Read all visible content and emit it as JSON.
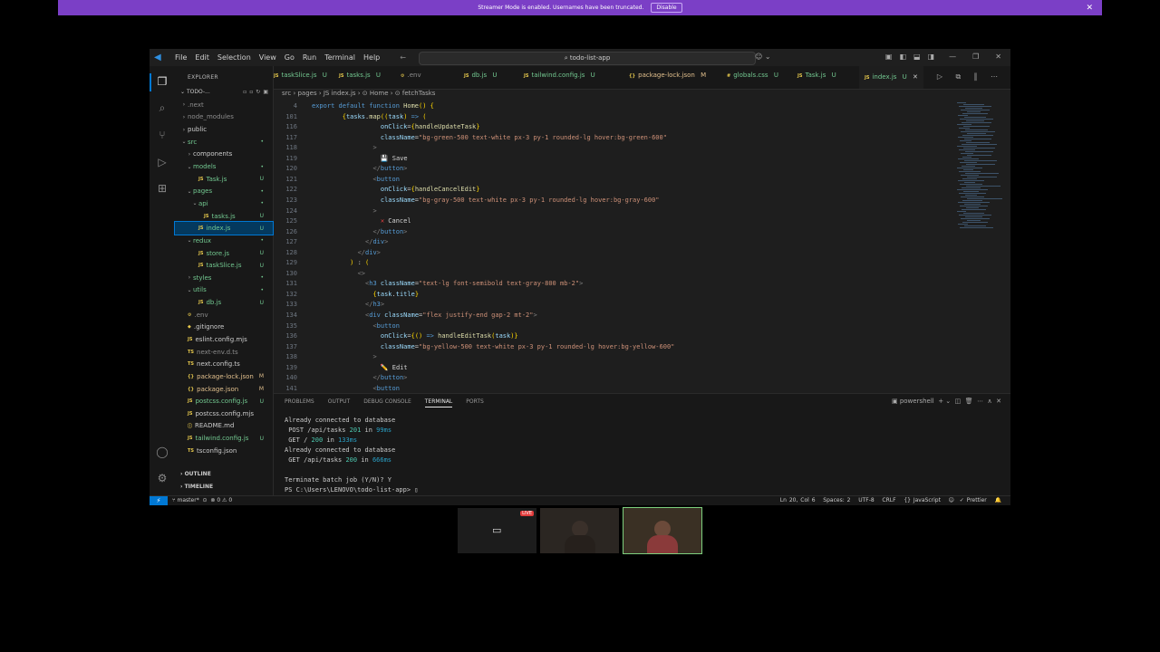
{
  "streamer_banner": {
    "text": "Streamer Mode is enabled. Usernames have been truncated.",
    "disable_label": "Disable",
    "close": "✕"
  },
  "titlebar": {
    "menu": [
      "File",
      "Edit",
      "Selection",
      "View",
      "Go",
      "Run",
      "Terminal",
      "Help"
    ],
    "search": "todo-list-app"
  },
  "sidebar": {
    "title": "EXPLORER",
    "root": "TODO-...",
    "tree": [
      {
        "name": ".next",
        "indent": 1,
        "chev": "›",
        "color": "grey",
        "status": ""
      },
      {
        "name": "node_modules",
        "indent": 1,
        "chev": "›",
        "color": "grey",
        "status": ""
      },
      {
        "name": "public",
        "indent": 1,
        "chev": "›",
        "color": "normal",
        "status": ""
      },
      {
        "name": "src",
        "indent": 1,
        "chev": "⌄",
        "color": "green",
        "status": "•"
      },
      {
        "name": "components",
        "indent": 2,
        "chev": "›",
        "color": "normal",
        "status": ""
      },
      {
        "name": "models",
        "indent": 2,
        "chev": "⌄",
        "color": "green",
        "status": "•"
      },
      {
        "name": "Task.js",
        "indent": 3,
        "icon": "JS",
        "color": "green",
        "status": "U"
      },
      {
        "name": "pages",
        "indent": 2,
        "chev": "⌄",
        "color": "green",
        "status": "•"
      },
      {
        "name": "api",
        "indent": 3,
        "chev": "⌄",
        "color": "green",
        "status": "•"
      },
      {
        "name": "tasks.js",
        "indent": 4,
        "icon": "JS",
        "color": "green",
        "status": "U"
      },
      {
        "name": "index.js",
        "indent": 3,
        "icon": "JS",
        "color": "green",
        "status": "U",
        "selected": true
      },
      {
        "name": "redux",
        "indent": 2,
        "chev": "⌄",
        "color": "green",
        "status": "•"
      },
      {
        "name": "store.js",
        "indent": 3,
        "icon": "JS",
        "color": "green",
        "status": "U"
      },
      {
        "name": "taskSlice.js",
        "indent": 3,
        "icon": "JS",
        "color": "green",
        "status": "U"
      },
      {
        "name": "styles",
        "indent": 2,
        "chev": "›",
        "color": "green",
        "status": "•"
      },
      {
        "name": "utils",
        "indent": 2,
        "chev": "⌄",
        "color": "green",
        "status": "•"
      },
      {
        "name": "db.js",
        "indent": 3,
        "icon": "JS",
        "color": "green",
        "status": "U"
      },
      {
        "name": ".env",
        "indent": 1,
        "icon": "⚙",
        "color": "grey",
        "status": ""
      },
      {
        "name": ".gitignore",
        "indent": 1,
        "icon": "◆",
        "color": "normal",
        "status": ""
      },
      {
        "name": "eslint.config.mjs",
        "indent": 1,
        "icon": "JS",
        "color": "normal",
        "status": ""
      },
      {
        "name": "next-env.d.ts",
        "indent": 1,
        "icon": "TS",
        "color": "grey",
        "status": ""
      },
      {
        "name": "next.config.ts",
        "indent": 1,
        "icon": "TS",
        "color": "normal",
        "status": ""
      },
      {
        "name": "package-lock.json",
        "indent": 1,
        "icon": "{}",
        "color": "yellow",
        "status": "M"
      },
      {
        "name": "package.json",
        "indent": 1,
        "icon": "{}",
        "color": "yellow",
        "status": "M"
      },
      {
        "name": "postcss.config.js",
        "indent": 1,
        "icon": "JS",
        "color": "green",
        "status": "U"
      },
      {
        "name": "postcss.config.mjs",
        "indent": 1,
        "icon": "JS",
        "color": "normal",
        "status": ""
      },
      {
        "name": "README.md",
        "indent": 1,
        "icon": "ⓘ",
        "color": "normal",
        "status": ""
      },
      {
        "name": "tailwind.config.js",
        "indent": 1,
        "icon": "JS",
        "color": "green",
        "status": "U"
      },
      {
        "name": "tsconfig.json",
        "indent": 1,
        "icon": "TS",
        "color": "normal",
        "status": ""
      }
    ],
    "outline": "OUTLINE",
    "timeline": "TIMELINE"
  },
  "tabs": [
    {
      "icon": "JS",
      "label": "taskSlice.js",
      "status": "U",
      "color": "green"
    },
    {
      "icon": "JS",
      "label": "tasks.js",
      "status": "U",
      "color": "green"
    },
    {
      "icon": "⚙",
      "label": ".env",
      "status": "",
      "color": "grey"
    },
    {
      "icon": "JS",
      "label": "db.js",
      "status": "U",
      "color": "green"
    },
    {
      "icon": "JS",
      "label": "tailwind.config.js",
      "status": "U",
      "color": "green"
    },
    {
      "icon": "{}",
      "label": "package-lock.json",
      "status": "M",
      "color": "yellow"
    },
    {
      "icon": "#",
      "label": "globals.css",
      "status": "U",
      "color": "green"
    },
    {
      "icon": "JS",
      "label": "Task.js",
      "status": "U",
      "color": "green"
    },
    {
      "icon": "JS",
      "label": "index.js",
      "status": "U",
      "color": "green",
      "active": true
    }
  ],
  "breadcrumb": "src › pages › JS index.js › ⊙ Home › ⊙ fetchTasks",
  "code_lines": [
    {
      "n": "4",
      "html": "<span class='kw'>export default function</span> <span class='fn'>Home</span><span class='br'>()</span> <span class='br'>{</span>"
    },
    {
      "n": "101",
      "html": "        <span class='br'>{</span><span class='attr'>tasks</span>.<span class='fn'>map</span><span class='br'>((</span><span class='attr'>task</span><span class='br'>)</span> <span class='kw'>=></span> <span class='br'>(</span>"
    },
    {
      "n": "116",
      "html": "                  <span class='attr'>onClick</span>=<span class='br'>{</span><span class='fn'>handleUpdateTask</span><span class='br'>}</span>"
    },
    {
      "n": "117",
      "html": "                  <span class='attr'>className</span>=<span class='str'>\"bg-green-500 text-white px-3 py-1 rounded-lg hover:bg-green-600\"</span>"
    },
    {
      "n": "118",
      "html": "                <span class='tag'>></span>"
    },
    {
      "n": "119",
      "html": "                  <span class='txt'>💾 Save</span>"
    },
    {
      "n": "120",
      "html": "                <span class='tag'>&lt;/</span><span class='tagn'>button</span><span class='tag'>></span>"
    },
    {
      "n": "121",
      "html": "                <span class='tag'>&lt;</span><span class='tagn'>button</span>"
    },
    {
      "n": "122",
      "html": "                  <span class='attr'>onClick</span>=<span class='br'>{</span><span class='fn'>handleCancelEdit</span><span class='br'>}</span>"
    },
    {
      "n": "123",
      "html": "                  <span class='attr'>className</span>=<span class='str'>\"bg-gray-500 text-white px-3 py-1 rounded-lg hover:bg-gray-600\"</span>"
    },
    {
      "n": "124",
      "html": "                <span class='tag'>></span>"
    },
    {
      "n": "125",
      "html": "                  <span class='txt'><span style='color:#e04040'>✕</span> Cancel</span>"
    },
    {
      "n": "126",
      "html": "                <span class='tag'>&lt;/</span><span class='tagn'>button</span><span class='tag'>></span>"
    },
    {
      "n": "127",
      "html": "              <span class='tag'>&lt;/</span><span class='tagn'>div</span><span class='tag'>></span>"
    },
    {
      "n": "128",
      "html": "            <span class='tag'>&lt;/</span><span class='tagn'>div</span><span class='tag'>></span>"
    },
    {
      "n": "129",
      "html": "          <span class='br'>)</span> : <span class='br'>(</span>"
    },
    {
      "n": "130",
      "html": "            <span class='tag'>&lt;></span>"
    },
    {
      "n": "131",
      "html": "              <span class='tag'>&lt;</span><span class='tagn'>h3</span> <span class='attr'>className</span>=<span class='str'>\"text-lg font-semibold text-gray-800 mb-2\"</span><span class='tag'>></span>"
    },
    {
      "n": "132",
      "html": "                <span class='br'>{</span><span class='attr'>task</span>.<span class='attr'>title</span><span class='br'>}</span>"
    },
    {
      "n": "133",
      "html": "              <span class='tag'>&lt;/</span><span class='tagn'>h3</span><span class='tag'>></span>"
    },
    {
      "n": "134",
      "html": "              <span class='tag'>&lt;</span><span class='tagn'>div</span> <span class='attr'>className</span>=<span class='str'>\"flex justify-end gap-2 mt-2\"</span><span class='tag'>></span>"
    },
    {
      "n": "135",
      "html": "                <span class='tag'>&lt;</span><span class='tagn'>button</span>"
    },
    {
      "n": "136",
      "html": "                  <span class='attr'>onClick</span>=<span class='br'>{</span><span class='br'>()</span> <span class='kw'>=></span> <span class='fn'>handleEditTask</span><span class='br'>(</span><span class='attr'>task</span><span class='br'>)}</span>"
    },
    {
      "n": "137",
      "html": "                  <span class='attr'>className</span>=<span class='str'>\"bg-yellow-500 text-white px-3 py-1 rounded-lg hover:bg-yellow-600\"</span>"
    },
    {
      "n": "138",
      "html": "                <span class='tag'>></span>"
    },
    {
      "n": "139",
      "html": "                  <span class='txt'>✏️ Edit</span>"
    },
    {
      "n": "140",
      "html": "                <span class='tag'>&lt;/</span><span class='tagn'>button</span><span class='tag'>></span>"
    },
    {
      "n": "141",
      "html": "                <span class='tag'>&lt;</span><span class='tagn'>button</span>"
    }
  ],
  "panel": {
    "tabs": [
      "PROBLEMS",
      "OUTPUT",
      "DEBUG CONSOLE",
      "TERMINAL",
      "PORTS"
    ],
    "active_tab": "TERMINAL",
    "shell": "powershell",
    "terminal_lines": [
      "Already connected to database",
      " POST /api/tasks <span class='tgreen'>201</span> in <span class='tcyan'>99ms</span>",
      " GET / <span class='tgreen'>200</span> in <span class='tcyan'>133ms</span>",
      "Already connected to database",
      " GET /api/tasks <span class='tgreen'>200</span> in <span class='tcyan'>666ms</span>",
      "",
      "Terminate batch job (Y/N)? Y",
      "PS C:\\Users\\LENOVO\\todo-list-app> ▯"
    ]
  },
  "statusbar": {
    "branch": "master*",
    "problems": "⊗ 0 ⚠ 0",
    "position": "Ln 20, Col 6",
    "spaces": "Spaces: 2",
    "encoding": "UTF-8",
    "eol": "CRLF",
    "language": "{} JavaScript",
    "prettier": "✓ Prettier"
  },
  "call": {
    "live_label": "LIVE"
  },
  "colors": {
    "accent": "#0078d4",
    "streamer": "#7b3fc6",
    "untracked": "#73c991",
    "modified": "#e2c08d"
  }
}
